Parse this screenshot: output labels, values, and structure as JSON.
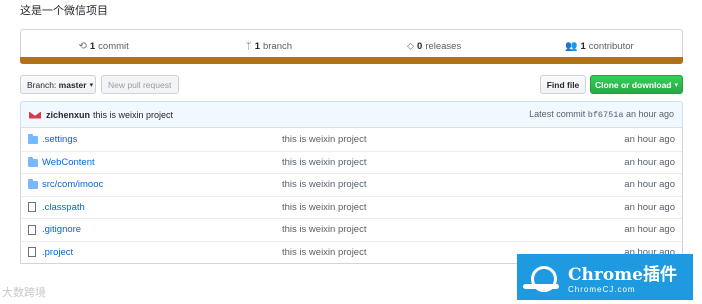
{
  "repo": {
    "description": "这是一个微信项目"
  },
  "summary": {
    "commits": {
      "count": "1",
      "label": "commit",
      "icon": "history-icon"
    },
    "branches": {
      "count": "1",
      "label": "branch",
      "icon": "branch-icon"
    },
    "releases": {
      "count": "0",
      "label": "releases",
      "icon": "tag-icon"
    },
    "contributors": {
      "count": "1",
      "label": "contributor",
      "icon": "people-icon"
    },
    "language_color": "#b07219"
  },
  "toolbar": {
    "branch_label": "Branch:",
    "branch_value": "master",
    "new_pr_label": "New pull request",
    "find_file_label": "Find file",
    "clone_label": "Clone or download"
  },
  "latest_commit": {
    "author": "zichenxun",
    "message": "this is weixin project",
    "prefix": "Latest commit",
    "sha": "bf6751a",
    "age": "an hour ago"
  },
  "files": [
    {
      "type": "folder",
      "name": ".settings",
      "message": "this is weixin project",
      "age": "an hour ago"
    },
    {
      "type": "folder",
      "name": "WebContent",
      "message": "this is weixin project",
      "age": "an hour ago"
    },
    {
      "type": "folder",
      "name": "src/com/imooc",
      "message": "this is weixin project",
      "age": "an hour ago"
    },
    {
      "type": "file",
      "name": ".classpath",
      "message": "this is weixin project",
      "age": "an hour ago"
    },
    {
      "type": "file",
      "name": ".gitignore",
      "message": "this is weixin project",
      "age": "an hour ago"
    },
    {
      "type": "file",
      "name": ".project",
      "message": "this is weixin project",
      "age": "an hour ago"
    }
  ],
  "watermarks": {
    "left": "大数跨境",
    "right_title": "Chrome插件",
    "right_sub": "ChromeCJ.com"
  }
}
